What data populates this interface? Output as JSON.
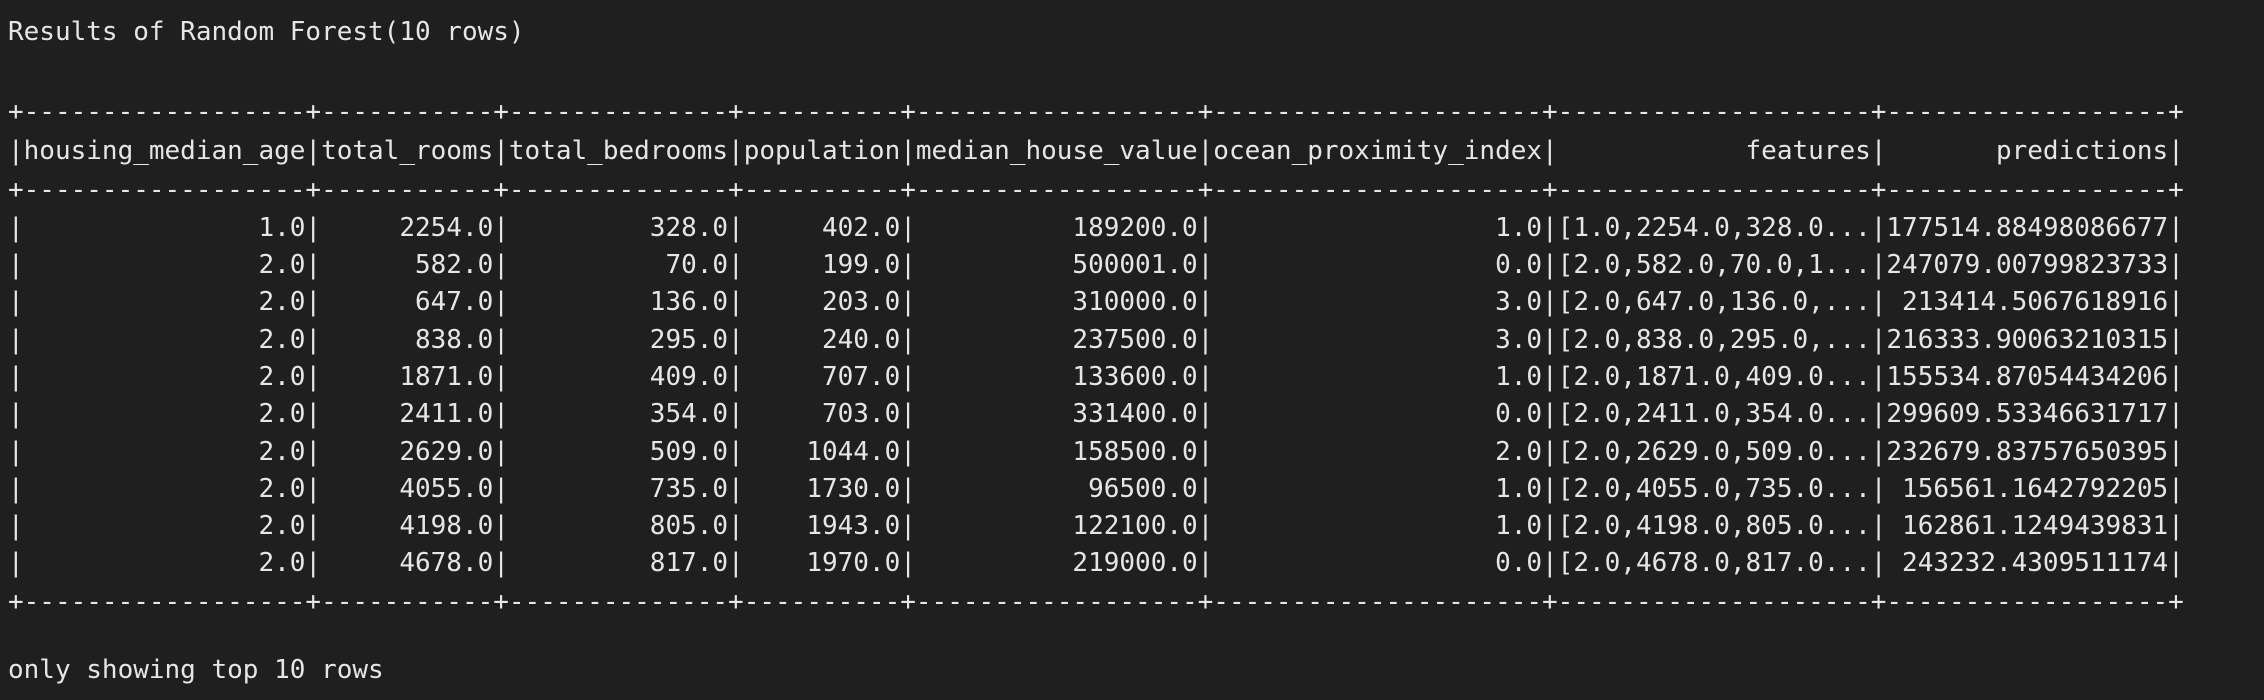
{
  "terminal": {
    "header": "Results of Random Forest(10 rows)",
    "table": {
      "separator": "+------------------+-----------+--------------+----------+------------------+---------------------+--------------------+------------------+",
      "columns_row": "|housing_median_age|total_rooms|total_bedrooms|population|median_house_value|ocean_proximity_index|            features|       predictions|",
      "rows": [
        "|               1.0|     2254.0|         328.0|     402.0|          189200.0|                  1.0|[1.0,2254.0,328.0...|177514.88498086677|",
        "|               2.0|      582.0|          70.0|     199.0|          500001.0|                  0.0|[2.0,582.0,70.0,1...|247079.00799823733|",
        "|               2.0|      647.0|         136.0|     203.0|          310000.0|                  3.0|[2.0,647.0,136.0,...| 213414.5067618916|",
        "|               2.0|      838.0|         295.0|     240.0|          237500.0|                  3.0|[2.0,838.0,295.0,...|216333.90063210315|",
        "|               2.0|     1871.0|         409.0|     707.0|          133600.0|                  1.0|[2.0,1871.0,409.0...|155534.87054434206|",
        "|               2.0|     2411.0|         354.0|     703.0|          331400.0|                  0.0|[2.0,2411.0,354.0...|299609.53346631717|",
        "|               2.0|     2629.0|         509.0|    1044.0|          158500.0|                  2.0|[2.0,2629.0,509.0...|232679.83757650395|",
        "|               2.0|     4055.0|         735.0|    1730.0|           96500.0|                  1.0|[2.0,4055.0,735.0...| 156561.1642792205|",
        "|               2.0|     4198.0|         805.0|    1943.0|          122100.0|                  1.0|[2.0,4198.0,805.0...| 162861.1249439831|",
        "|               2.0|     4678.0|         817.0|    1970.0|          219000.0|                  0.0|[2.0,4678.0,817.0...| 243232.4309511174|"
      ]
    },
    "footer": "only showing top 10 rows"
  }
}
